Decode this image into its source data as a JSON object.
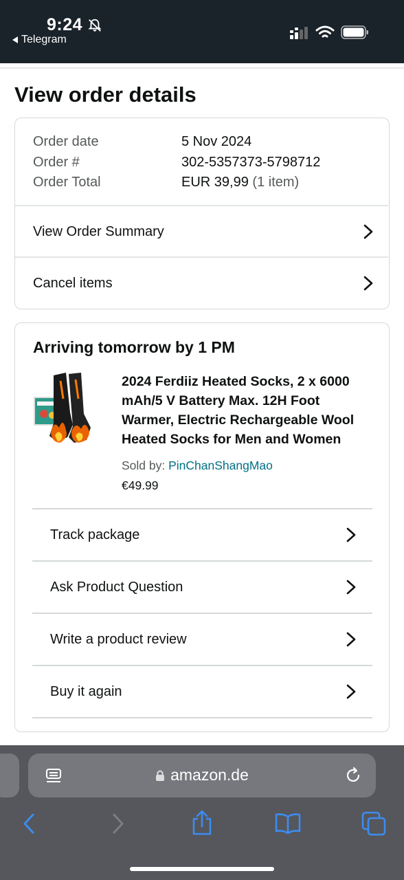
{
  "status_bar": {
    "time": "9:24",
    "back_app": "Telegram",
    "icons": [
      "bell-slash-icon",
      "signal-icon",
      "wifi-icon",
      "battery-icon"
    ]
  },
  "page_title": "View order details",
  "order": {
    "date_label": "Order date",
    "date_value": "5 Nov 2024",
    "number_label": "Order #",
    "number_value": "302-5357373-5798712",
    "total_label": "Order Total",
    "total_value": "EUR 39,99",
    "total_items": "(1 item)",
    "links": [
      {
        "label": "View Order Summary"
      },
      {
        "label": "Cancel items"
      }
    ]
  },
  "shipment": {
    "status": "Arriving tomorrow by 1 PM",
    "product": {
      "title": "2024 Ferdiiz Heated Socks, 2 x 6000 mAh/5 V Battery Max. 12H Foot Warmer, Electric Rechargeable Wool Heated Socks for Men and Women",
      "sold_by_label": "Sold by: ",
      "seller": "PinChanShangMao",
      "price": "€49.99"
    },
    "actions": [
      {
        "label": "Track package"
      },
      {
        "label": "Ask Product Question"
      },
      {
        "label": "Write a product review"
      },
      {
        "label": "Buy it again"
      }
    ]
  },
  "browser": {
    "url": "amazon.de"
  },
  "colors": {
    "link_teal": "#007185",
    "status_bar_bg": "#1a222a",
    "browser_bar_bg": "#55575c",
    "ios_blue": "#3d8cf0"
  }
}
